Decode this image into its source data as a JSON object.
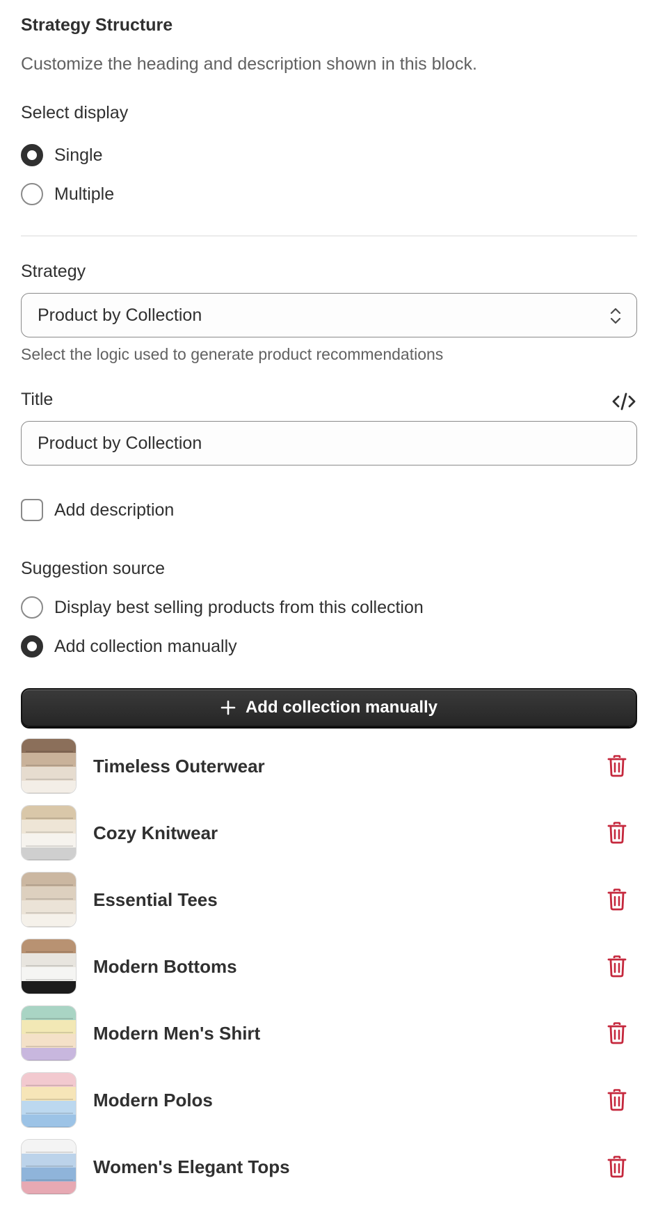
{
  "block": {
    "title": "Strategy Structure",
    "description": "Customize the heading and description shown in this block."
  },
  "display": {
    "label": "Select display",
    "options": [
      {
        "label": "Single",
        "selected": true
      },
      {
        "label": "Multiple",
        "selected": false
      }
    ]
  },
  "strategy": {
    "label": "Strategy",
    "value": "Product by Collection",
    "help": "Select the logic used to generate product recommendations"
  },
  "title_field": {
    "label": "Title",
    "value": "Product by Collection",
    "code_icon": "code-icon"
  },
  "add_description": {
    "label": "Add description",
    "checked": false
  },
  "suggestion_source": {
    "label": "Suggestion source",
    "options": [
      {
        "label": "Display best selling products from this collection",
        "selected": false
      },
      {
        "label": "Add collection manually",
        "selected": true
      }
    ]
  },
  "add_collection_button": {
    "label": "Add collection manually",
    "icon": "plus-icon"
  },
  "collections": [
    {
      "name": "Timeless Outerwear",
      "thumb_colors": [
        "#8b6f5a",
        "#c9b29a",
        "#e6dccf",
        "#f3eee7"
      ]
    },
    {
      "name": "Cozy Knitwear",
      "thumb_colors": [
        "#d9c7a9",
        "#eee5d6",
        "#f6f3ee",
        "#cfcfcf"
      ]
    },
    {
      "name": "Essential Tees",
      "thumb_colors": [
        "#cbb7a1",
        "#ddd0bf",
        "#ebe3d7",
        "#f5f1ea"
      ]
    },
    {
      "name": "Modern Bottoms",
      "thumb_colors": [
        "#b89272",
        "#e8e5df",
        "#f5f5f3",
        "#1c1c1c"
      ]
    },
    {
      "name": "Modern Men's Shirt",
      "thumb_colors": [
        "#a9d4c4",
        "#f2e8b5",
        "#f4e1c8",
        "#c8b7de"
      ]
    },
    {
      "name": "Modern Polos",
      "thumb_colors": [
        "#f2c9cf",
        "#f6e5b8",
        "#bcd8ef",
        "#9cc3e6"
      ]
    },
    {
      "name": "Women's Elegant Tops",
      "thumb_colors": [
        "#f4f4f4",
        "#bcd3ea",
        "#8fb4da",
        "#e7a9b3"
      ]
    }
  ],
  "colors": {
    "primary": "#303030",
    "danger": "#c5283d",
    "muted_text": "#616161",
    "border": "#8a8a8a"
  }
}
